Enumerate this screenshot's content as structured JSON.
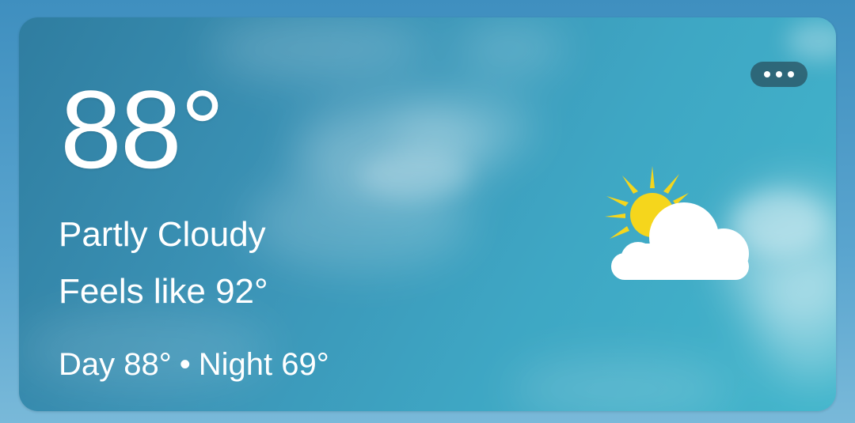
{
  "widget": {
    "temperature": "88°",
    "condition": "Partly Cloudy",
    "feels_like": "Feels like 92°",
    "day_label": "Day 88°",
    "separator": "•",
    "night_label": "Night 69°",
    "icon": "partly-cloudy-icon",
    "more_icon": "more-horizontal-icon"
  },
  "colors": {
    "sun": "#f5d61c",
    "cloud": "#ffffff",
    "text": "#ffffff"
  }
}
